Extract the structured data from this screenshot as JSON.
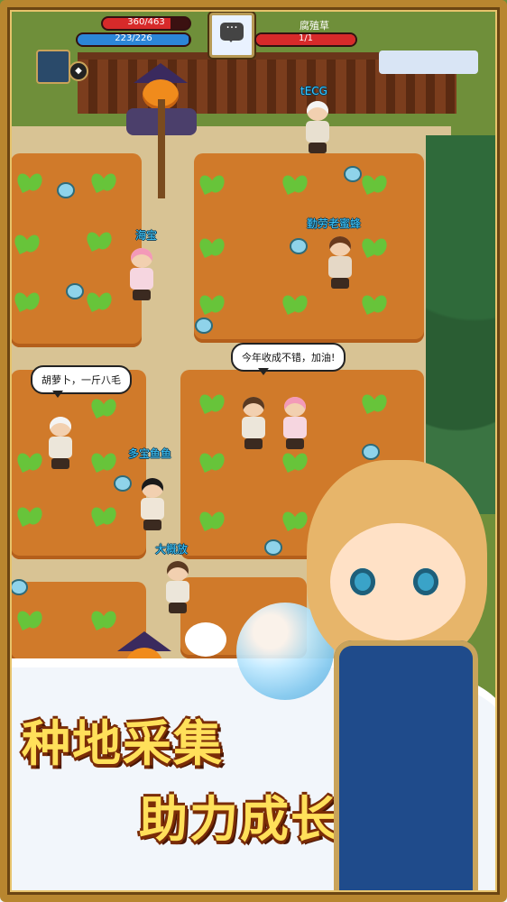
{
  "hud": {
    "hp_text": "360/463",
    "mp_text": "223/226",
    "target_name": "腐殖草",
    "target_hp_text": "1/1"
  },
  "players": {
    "tecg": "tECG",
    "haibao": "海宝",
    "qinlao": "勤劳老蜜蜂",
    "duobao": "多宝鱼鱼",
    "dagai": "大概放"
  },
  "speech": {
    "left": "胡萝卜，一斤八毛",
    "right": "今年收成不错，加油!"
  },
  "slogan": {
    "line1": "种地采集",
    "line2": "助力成长"
  },
  "icons": {
    "chat": "chat-bubble-icon",
    "avatar": "ellipsis-chat-icon"
  },
  "colors": {
    "hp": "#d72a2a",
    "mp": "#2c86d8",
    "name": "#3ec8ff",
    "slogan_fill": "#ffe05a",
    "slogan_outline": "#7a2c07"
  }
}
